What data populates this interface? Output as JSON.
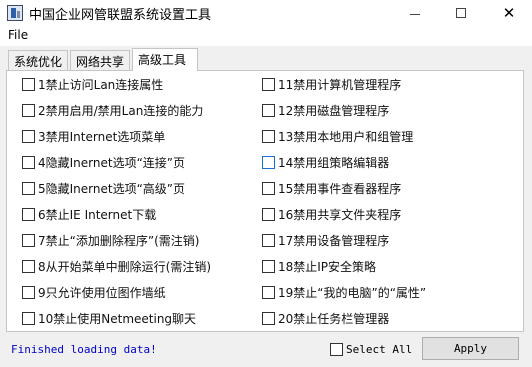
{
  "window": {
    "title": "中国企业网管联盟系统设置工具",
    "minimize_glyph": "",
    "close_glyph": "✕"
  },
  "menu": {
    "file": "File"
  },
  "tabs": [
    {
      "label": "系统优化",
      "active": false
    },
    {
      "label": "网络共享",
      "active": false
    },
    {
      "label": "高级工具",
      "active": true
    }
  ],
  "options_left": [
    "1禁止访问Lan连接属性",
    "2禁用启用/禁用Lan连接的能力",
    "3禁用Internet选项菜单",
    "4隐藏Inernet选项“连接”页",
    "5隐藏Inernet选项“高级”页",
    "6禁止IE Internet下载",
    "7禁止“添加删除程序”(需注销)",
    "8从开始菜单中删除运行(需注销)",
    "9只允许使用位图作墙纸",
    "10禁止使用Netmeeting聊天"
  ],
  "options_right": [
    "11禁用计算机管理程序",
    "12禁用磁盘管理程序",
    "13禁用本地用户和组管理",
    "14禁用组策略编辑器",
    "15禁用事件查看器程序",
    "16禁用共享文件夹程序",
    "17禁用设备管理程序",
    "18禁止IP安全策略",
    "19禁止“我的电脑”的“属性”",
    "20禁止任务栏管理器"
  ],
  "footer": {
    "status": "Finished loading data!",
    "select_all": "Select All",
    "apply": "Apply"
  },
  "colors": {
    "status_text": "#0000c8",
    "focus_checkbox": "#1a6fd0"
  }
}
